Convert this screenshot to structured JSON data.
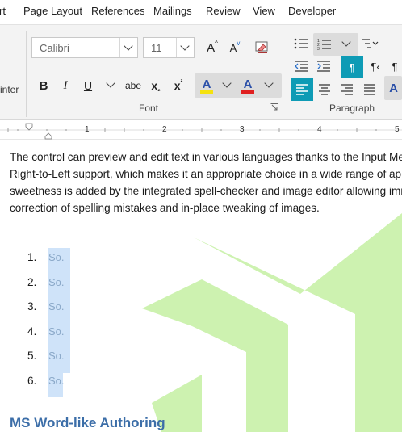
{
  "menu": {
    "tabs": [
      "rt",
      "Page Layout",
      "References",
      "Mailings",
      "Review",
      "View",
      "Developer"
    ]
  },
  "ribbon": {
    "clipboard_label_partial": "inter",
    "font": {
      "family_value": "Calibri",
      "size_value": "11",
      "grow_label": "A",
      "shrink_label": "A",
      "bold_label": "B",
      "italic_label": "I",
      "underline_label": "U",
      "strike_label": "abe",
      "subscript_label": "x",
      "superscript_label": "x",
      "highlight_label": "A",
      "fontcolor_label": "A",
      "group_label": "Font"
    },
    "paragraph": {
      "group_label": "Paragraph"
    },
    "colors": {
      "accent": "#0e9bb5",
      "highlight": "#f5e20e",
      "font_color": "#e02020"
    }
  },
  "ruler": {
    "numbers": [
      "1",
      "2",
      "3",
      "4",
      "5"
    ]
  },
  "document": {
    "paragraph_lines": [
      "The control can preview and edit text in various languages thanks to the Input Met",
      "Right-to-Left support, which makes it an appropriate choice in a wide range of app",
      "sweetness is added by the integrated spell-checker and image editor allowing imm",
      "correction of spelling mistakes and in-place tweaking of images."
    ],
    "list_numbers": [
      "1.",
      "2.",
      "3.",
      "4.",
      "5.",
      "6."
    ],
    "list_items": [
      "So.",
      "So.",
      "So.",
      "So.",
      "So.",
      "So."
    ],
    "heading": "MS Word-like Authoring",
    "watermark_color": "#cdf2b0"
  }
}
